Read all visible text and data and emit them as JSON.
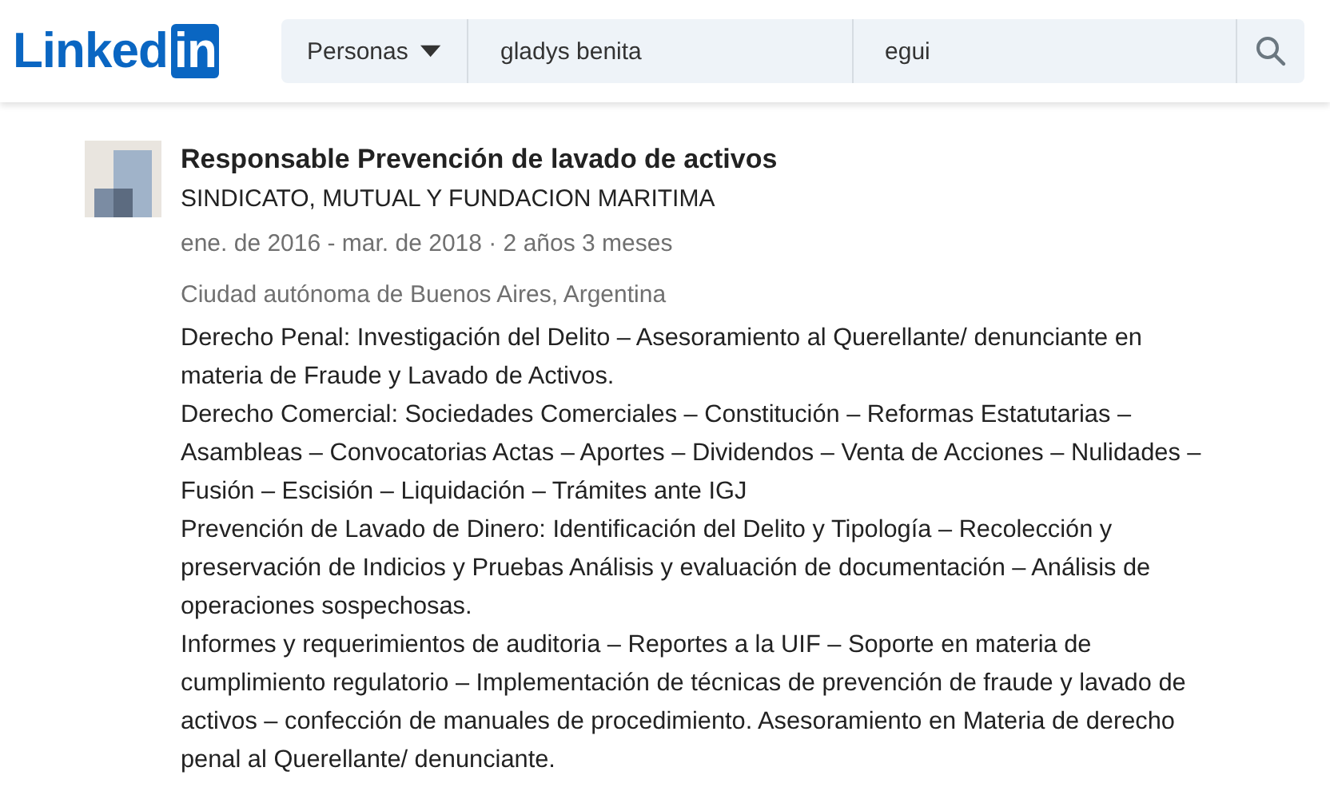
{
  "header": {
    "logo": {
      "word": "Linked",
      "badge": "in"
    },
    "search": {
      "category": "Personas",
      "first_name": "gladys benita",
      "last_name": "egui"
    }
  },
  "experience": {
    "title": "Responsable Prevención de lavado de activos",
    "company": "SINDICATO, MUTUAL Y FUNDACION MARITIMA",
    "dates": "ene. de 2016 - mar. de 2018 · 2 años 3 meses",
    "location": "Ciudad autónoma de Buenos Aires, Argentina",
    "description": [
      "Derecho Penal: Investigación del Delito – Asesoramiento al Querellante/ denunciante en materia de Fraude y Lavado de Activos.",
      "Derecho Comercial: Sociedades Comerciales – Constitución – Reformas Estatutarias – Asambleas – Convocatorias Actas – Aportes – Dividendos – Venta de Acciones – Nulidades – Fusión – Escisión – Liquidación – Trámites ante IGJ",
      "Prevención de Lavado de Dinero: Identificación del Delito y Tipología – Recolección y preservación de Indicios y Pruebas Análisis y evaluación de documentación – Análisis de operaciones sospechosas.",
      "Informes y requerimientos de auditoria – Reportes a la UIF – Soporte en materia de cumplimiento regulatorio – Implementación de técnicas de prevención de fraude y lavado de activos – confección de manuales de procedimiento. Asesoramiento en Materia de derecho penal al Querellante/ denunciante."
    ]
  }
}
